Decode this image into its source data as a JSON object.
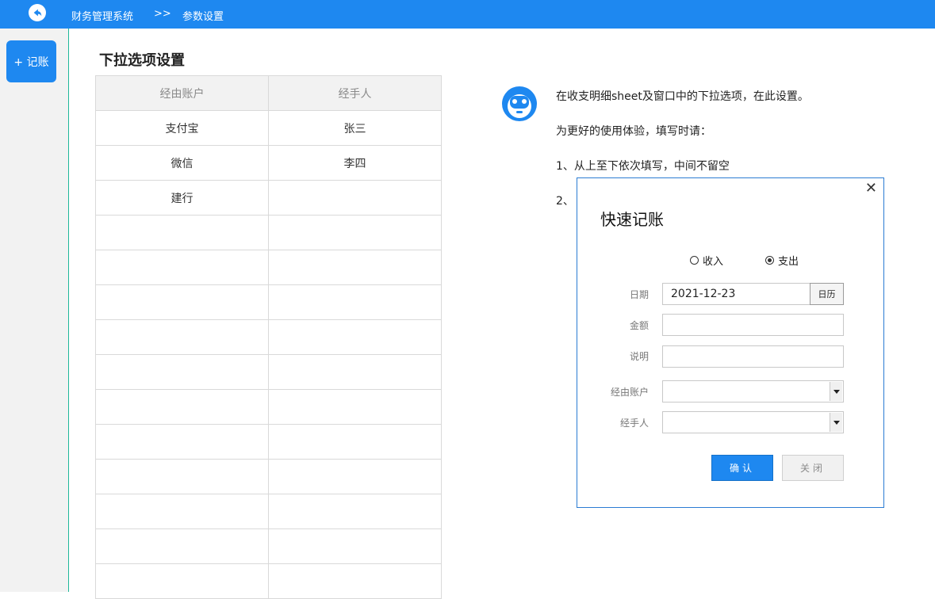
{
  "topbar": {
    "crumb_system": "财务管理系统",
    "separator": ">>",
    "crumb_page": "参数设置"
  },
  "sidebar": {
    "record_button": "+ 记账"
  },
  "section": {
    "title": "下拉选项设置"
  },
  "table": {
    "headers": [
      "经由账户",
      "经手人"
    ],
    "rows": [
      [
        "支付宝",
        "张三"
      ],
      [
        "微信",
        "李四"
      ],
      [
        "建行",
        ""
      ],
      [
        "",
        ""
      ],
      [
        "",
        ""
      ],
      [
        "",
        ""
      ],
      [
        "",
        ""
      ],
      [
        "",
        ""
      ],
      [
        "",
        ""
      ],
      [
        "",
        ""
      ],
      [
        "",
        ""
      ],
      [
        "",
        ""
      ],
      [
        "",
        ""
      ],
      [
        "",
        ""
      ]
    ]
  },
  "info": {
    "line1": "在收支明细sheet及窗口中的下拉选项，在此设置。",
    "line2": "为更好的使用体验，填写时请：",
    "line3": "1、从上至下依次填写，中间不留空",
    "line4": "2、"
  },
  "modal": {
    "close_symbol": "✕",
    "title": "快速记账",
    "radio_income": "收入",
    "radio_expense": "支出",
    "selected_radio": "支出",
    "label_date": "日期",
    "date_value": "2021-12-23",
    "calendar_button": "日历",
    "label_amount": "金额",
    "amount_value": "",
    "label_note": "说明",
    "note_value": "",
    "label_account": "经由账户",
    "account_value": "",
    "label_handler": "经手人",
    "handler_value": "",
    "ok_button": "确认",
    "close_button": "关闭"
  },
  "colors": {
    "accent": "#1e88f0",
    "rail_border": "#1fb89a",
    "modal_border": "#2b7cd3"
  }
}
